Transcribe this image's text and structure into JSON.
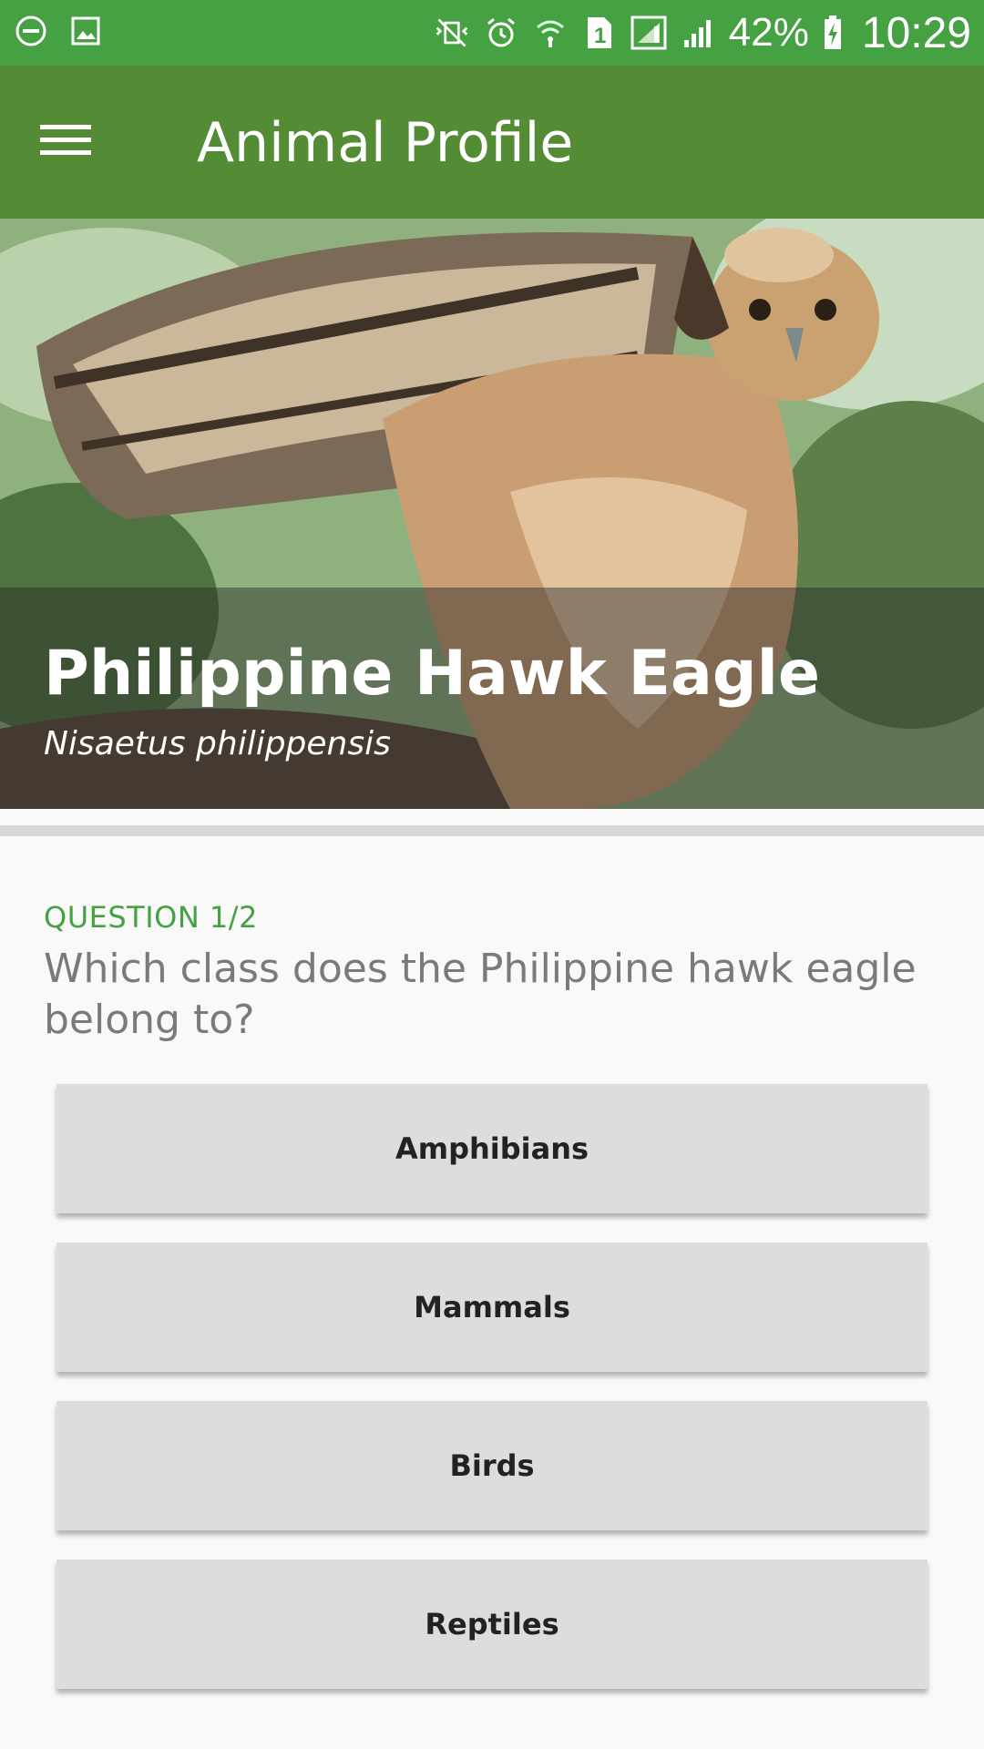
{
  "status_bar": {
    "battery_percent": "42%",
    "time": "10:29",
    "sim_label": "1",
    "left_icons": [
      "do-not-disturb-icon",
      "image-icon"
    ],
    "right_icons": [
      "vibrate-off-icon",
      "alarm-icon",
      "wifi-icon",
      "sim-1-icon",
      "signal-icon",
      "signal-icon",
      "battery-charging-icon"
    ]
  },
  "app_bar": {
    "title": "Animal Profile",
    "menu_icon": "hamburger-menu-icon"
  },
  "hero": {
    "name": "Philippine Hawk Eagle",
    "scientific_name": "Nisaetus philippensis"
  },
  "quiz": {
    "progress_label": "QUESTION 1/2",
    "question": "Which class does the Philippine hawk eagle belong to?",
    "answers": [
      {
        "label": "Amphibians"
      },
      {
        "label": "Mammals"
      },
      {
        "label": "Birds"
      },
      {
        "label": "Reptiles"
      }
    ]
  },
  "colors": {
    "status_bar": "#45a142",
    "app_bar": "#538c34",
    "accent": "#45a142",
    "answer_bg": "#dddddd"
  }
}
